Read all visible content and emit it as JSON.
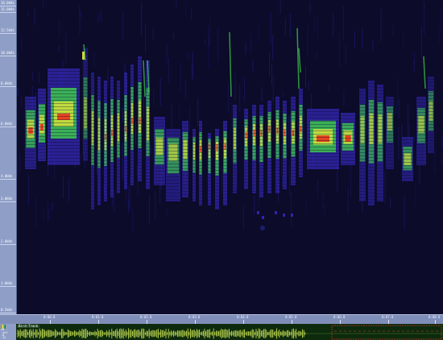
{
  "freq_axis": {
    "labels": [
      "16.0kHz",
      "15.0kHz",
      "12.5kHz",
      "10.0kHz",
      "8.0kHz",
      "6.0kHz",
      "4.0kHz",
      "3.0kHz",
      "2.0kHz",
      "1.0kHz",
      "0.5kHz"
    ]
  },
  "time_axis": {
    "labels": [
      "0:00.0",
      "0:01.0",
      "0:02.0",
      "0:03.0",
      "0:04.0",
      "0:05.0",
      "0:06.0",
      "0:07.0",
      "0:08.0"
    ]
  },
  "waveform": {
    "track_name": "Bird-Track",
    "side_labels": [
      "+0",
      "-inf",
      "-6",
      "-12"
    ],
    "selection_color": "#c0392b",
    "wave_color": "#d8ef5a"
  },
  "palette": {
    "background": "#0c0b2a",
    "low": "#3a2cc9",
    "mid": "#3fd24a",
    "high": "#e8e93a",
    "peak": "#e8321e"
  }
}
